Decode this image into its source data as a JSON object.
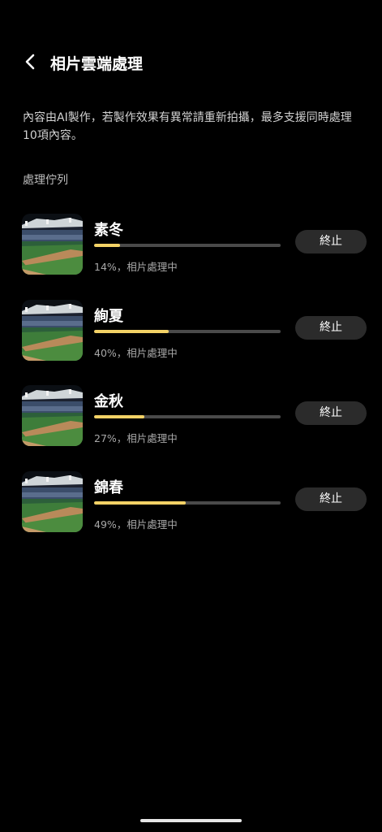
{
  "header": {
    "back_icon": "chevron-left-icon",
    "title": "相片雲端處理"
  },
  "description": "內容由AI製作，若製作效果有異常請重新拍攝，最多支援同時處理10項內容。",
  "queue": {
    "label": "處理佇列",
    "stop_label": "終止",
    "items": [
      {
        "name": "素冬",
        "progress": 14,
        "status": "14%，相片處理中",
        "thumbnail": "baseball-stadium-photo"
      },
      {
        "name": "絢夏",
        "progress": 40,
        "status": "40%，相片處理中",
        "thumbnail": "baseball-stadium-photo"
      },
      {
        "name": "金秋",
        "progress": 27,
        "status": "27%，相片處理中",
        "thumbnail": "baseball-stadium-photo"
      },
      {
        "name": "錦春",
        "progress": 49,
        "status": "49%，相片處理中",
        "thumbnail": "baseball-stadium-photo"
      }
    ]
  },
  "colors": {
    "background": "#000000",
    "progress_fill": "#f3d266",
    "progress_track": "#4a4a4a",
    "button_bg": "#2b2b2b"
  }
}
